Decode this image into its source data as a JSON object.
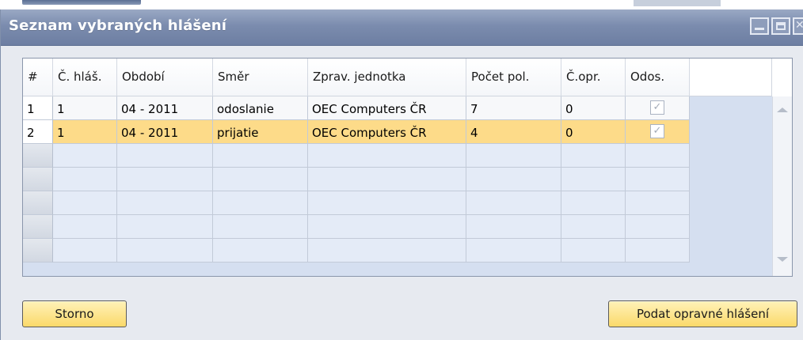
{
  "window": {
    "title": "Seznam vybraných hlášení"
  },
  "grid": {
    "headers": [
      "#",
      "Č. hláš.",
      "Období",
      "Směr",
      "Zprav. jednotka",
      "Počet pol.",
      "Č.opr.",
      "Odos."
    ],
    "rows": [
      {
        "num": "1",
        "c_hlas": "1",
        "obdobi": "04 - 2011",
        "smer": "odoslanie",
        "jednotka": "OEC Computers ČR",
        "pocet": "7",
        "c_opr": "0",
        "odos": "checked",
        "selected": false
      },
      {
        "num": "2",
        "c_hlas": "1",
        "obdobi": "04 - 2011",
        "smer": "prijatie",
        "jednotka": "OEC Computers ČR",
        "pocet": "4",
        "c_opr": "0",
        "odos": "checked",
        "selected": true
      }
    ],
    "empty_rows": 5
  },
  "buttons": {
    "cancel": "Storno",
    "submit": "Podat opravné hlášení"
  },
  "colors": {
    "titlebar": "#7b8cae",
    "selected_row": "#fddb89",
    "button": "#fbd96a"
  },
  "icons": {
    "minimize": "minimize-icon",
    "maximize": "maximize-icon",
    "close": "close-icon",
    "check": "check-icon"
  }
}
